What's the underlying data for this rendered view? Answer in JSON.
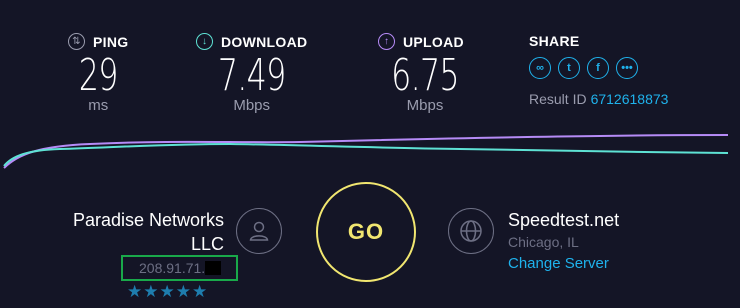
{
  "metrics": {
    "ping": {
      "label": "PING",
      "value": "29",
      "unit": "ms",
      "icon": "ping-icon"
    },
    "download": {
      "label": "DOWNLOAD",
      "value": "7.49",
      "unit": "Mbps",
      "icon": "download-arrow-icon",
      "color": "#5ee2d4"
    },
    "upload": {
      "label": "UPLOAD",
      "value": "6.75",
      "unit": "Mbps",
      "icon": "upload-arrow-icon",
      "color": "#b68bf7"
    }
  },
  "share": {
    "label": "SHARE",
    "icons": [
      "link-icon",
      "twitter-icon",
      "facebook-icon",
      "more-icon"
    ],
    "result_label": "Result ID",
    "result_id": "6712618873"
  },
  "isp": {
    "name_line1": "Paradise Networks",
    "name_line2": "LLC",
    "ip": "208.91.71.",
    "rating": "★★★★★",
    "icon": "user-icon"
  },
  "go_label": "GO",
  "server": {
    "name": "Speedtest.net",
    "location": "Chicago, IL",
    "change_label": "Change Server",
    "icon": "globe-icon"
  },
  "colors": {
    "background": "#141526",
    "accent_blue": "#1fb2ec",
    "go_yellow": "#f1e670",
    "highlight_green": "#19a94a"
  }
}
